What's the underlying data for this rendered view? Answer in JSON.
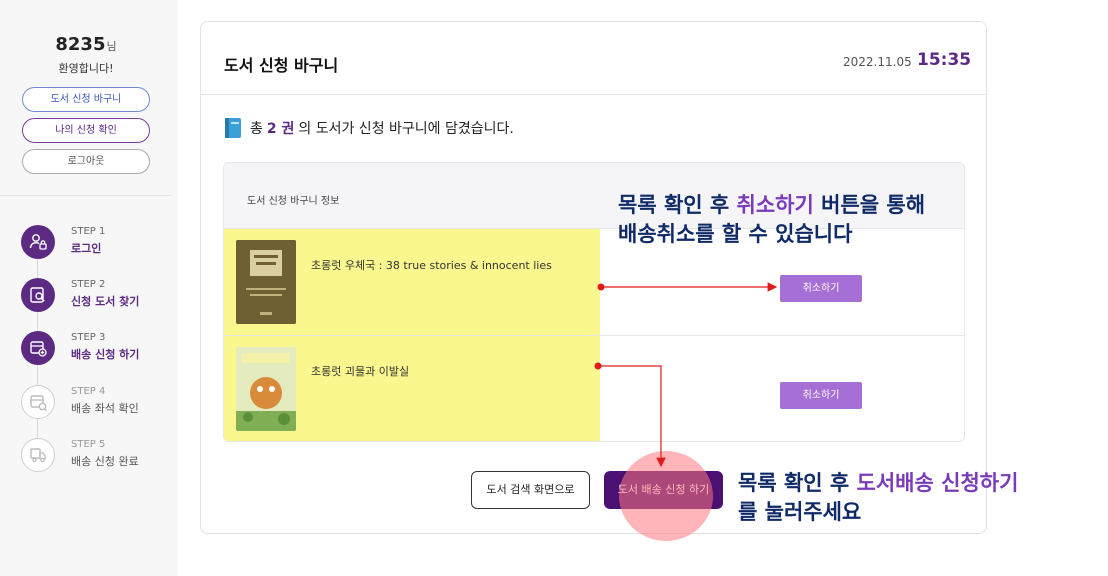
{
  "sidebar": {
    "user_id": "8235",
    "user_suffix": "님",
    "welcome": "환영합니다!",
    "buttons": {
      "cart": "도서 신청 바구니",
      "my_requests": "나의 신청 확인",
      "logout": "로그아웃"
    },
    "steps": [
      {
        "num": "STEP 1",
        "label": "로그인",
        "icon": "user-lock-icon",
        "active": true
      },
      {
        "num": "STEP 2",
        "label": "신청 도서 찾기",
        "icon": "book-search-icon",
        "active": true
      },
      {
        "num": "STEP 3",
        "label": "배송 신청 하기",
        "icon": "delivery-add-icon",
        "active": true
      },
      {
        "num": "STEP 4",
        "label": "배송 좌석 확인",
        "icon": "seat-check-icon",
        "active": false
      },
      {
        "num": "STEP 5",
        "label": "배송 신청 완료",
        "icon": "delivery-truck-icon",
        "active": false
      }
    ]
  },
  "main": {
    "title": "도서 신청 바구니",
    "date": "2022.11.05",
    "time": "15:35",
    "count_prefix": "총",
    "count_num": "2 권",
    "count_suffix": "의 도서가 신청 바구니에 담겼습니다.",
    "cart_header": "도서 신청 바구니 정보",
    "books": [
      {
        "title": "초롱럿 우체국 : 38 true stories & innocent lies",
        "action": "취소하기"
      },
      {
        "title": "초롱럿 괴물과 이발실",
        "action": "취소하기"
      }
    ],
    "buttons": {
      "back_to_search": "도서 검색 화면으로",
      "apply_delivery": "도서 배송 신청 하기"
    }
  },
  "annotations": {
    "cancel_line1_a": "목록 확인 후 ",
    "cancel_line1_hl": "취소하기",
    "cancel_line1_b": " 버튼을 통해",
    "cancel_line2": "배송취소를 할 수 있습니다",
    "apply_line1_a": "목록 확인 후 ",
    "apply_line1_hl": "도서배송 신청하기",
    "apply_line2": "를 눌러주세요"
  },
  "colors": {
    "brand_purple": "#5c2a83",
    "cancel_button": "#a56fd6",
    "apply_button": "#4a1172",
    "highlight": "#faf78e",
    "annotation_text": "#0f2a66",
    "arrow": "#e01b1b"
  }
}
